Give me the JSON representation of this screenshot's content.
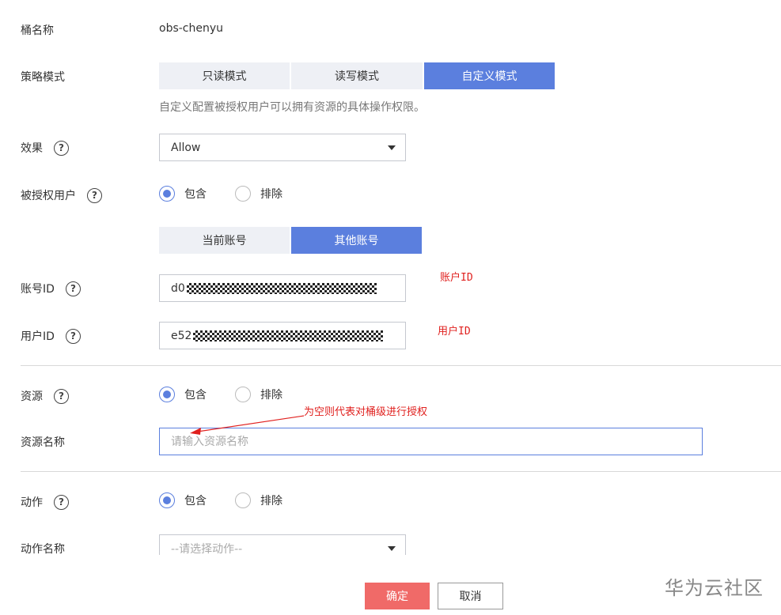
{
  "bucket": {
    "label": "桶名称",
    "value": "obs-chenyu"
  },
  "policy_mode": {
    "label": "策略模式",
    "options": [
      "只读模式",
      "读写模式",
      "自定义模式"
    ],
    "hint": "自定义配置被授权用户可以拥有资源的具体操作权限。"
  },
  "effect": {
    "label": "效果",
    "value": "Allow"
  },
  "grantee": {
    "label": "被授权用户",
    "include": "包含",
    "exclude": "排除",
    "tabs": [
      "当前账号",
      "其他账号"
    ]
  },
  "account_id": {
    "label": "账号ID",
    "value_prefix": "d0",
    "annotation": "账户ID"
  },
  "user_id": {
    "label": "用户ID",
    "value_prefix": "e52",
    "annotation": "用户ID"
  },
  "resource": {
    "label": "资源",
    "include": "包含",
    "exclude": "排除",
    "name_label": "资源名称",
    "name_placeholder": "请输入资源名称",
    "annotation": "为空则代表对桶级进行授权"
  },
  "action": {
    "label": "动作",
    "include": "包含",
    "exclude": "排除",
    "name_label": "动作名称",
    "name_placeholder": "--请选择动作--"
  },
  "footer": {
    "confirm": "确定",
    "cancel": "取消"
  },
  "watermark": "华为云社区",
  "help_glyph": "?",
  "colors": {
    "primary": "#5b7fde",
    "danger_button": "#f06a68",
    "annotation": "#e0201e",
    "segment_bg": "#eef0f5"
  }
}
